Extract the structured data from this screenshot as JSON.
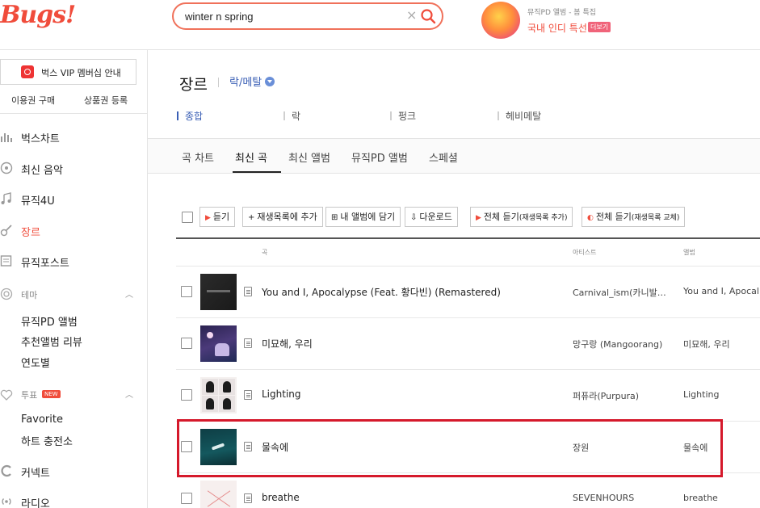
{
  "header": {
    "logo": "Bugs!",
    "search": {
      "value": "winter n spring",
      "clear": "×"
    },
    "promo": {
      "subtitle": "뮤직PD 앨범 - 봄 특집",
      "title": "국내 인디 특선",
      "more": "더보기"
    }
  },
  "sidebar": {
    "vip": "벅스 VIP 멤버십 안내",
    "links": [
      "이용권 구매",
      "상품권 등록"
    ],
    "nav": [
      {
        "label": "벅스차트",
        "icon": "chart-icon"
      },
      {
        "label": "최신 음악",
        "icon": "disc-icon"
      },
      {
        "label": "뮤직4U",
        "icon": "music-note-icon"
      },
      {
        "label": "장르",
        "icon": "guitar-icon",
        "active": true
      },
      {
        "label": "뮤직포스트",
        "icon": "post-icon"
      }
    ],
    "theme": {
      "label": "테마",
      "items": [
        "뮤직PD 앨범",
        "추천앨범 리뷰",
        "연도별"
      ]
    },
    "vote": {
      "label": "투표",
      "badge": "NEW",
      "items": [
        "Favorite",
        "하트 충전소"
      ]
    },
    "bottom": [
      {
        "label": "커넥트",
        "icon": "connect-icon"
      },
      {
        "label": "라디오",
        "icon": "radio-icon"
      }
    ]
  },
  "main": {
    "title": "장르",
    "genre": "락/메탈",
    "subtabs": [
      "종합",
      "락",
      "펑크",
      "헤비메탈"
    ],
    "tabs": [
      "곡 차트",
      "최신 곡",
      "최신 앨범",
      "뮤직PD 앨범",
      "스페셜"
    ],
    "active_tab": "최신 곡",
    "toolbar": {
      "listen": "듣기",
      "add_playlist": "재생목록에 추가",
      "add_album": "내 앨범에 담기",
      "download": "다운로드",
      "play_all_add": "전체 듣기",
      "play_all_add_sub": "(재생목록 추가)",
      "play_all_replace": "전체 듣기",
      "play_all_replace_sub": "(재생목록 교체)"
    },
    "columns": {
      "song": "곡",
      "artist": "아티스트",
      "album": "앨범"
    },
    "rows": [
      {
        "title": "You and I, Apocalypse (Feat. 황다빈) (Remastered)",
        "artist": "Carnival_ism(카니발…",
        "album": "You and I, Apocal…"
      },
      {
        "title": "미묘해, 우리",
        "artist": "망구랑 (Mangoorang)",
        "album": "미묘해, 우리"
      },
      {
        "title": "Lighting",
        "artist": "퍼퓨라(Purpura)",
        "album": "Lighting"
      },
      {
        "title": "물속에",
        "artist": "장원",
        "album": "물속에"
      },
      {
        "title": "breathe",
        "artist": "SEVENHOURS",
        "album": "breathe"
      }
    ]
  },
  "colors": {
    "brand": "#f04c3b",
    "link": "#3a5fb5",
    "highlight": "#d5192b"
  }
}
